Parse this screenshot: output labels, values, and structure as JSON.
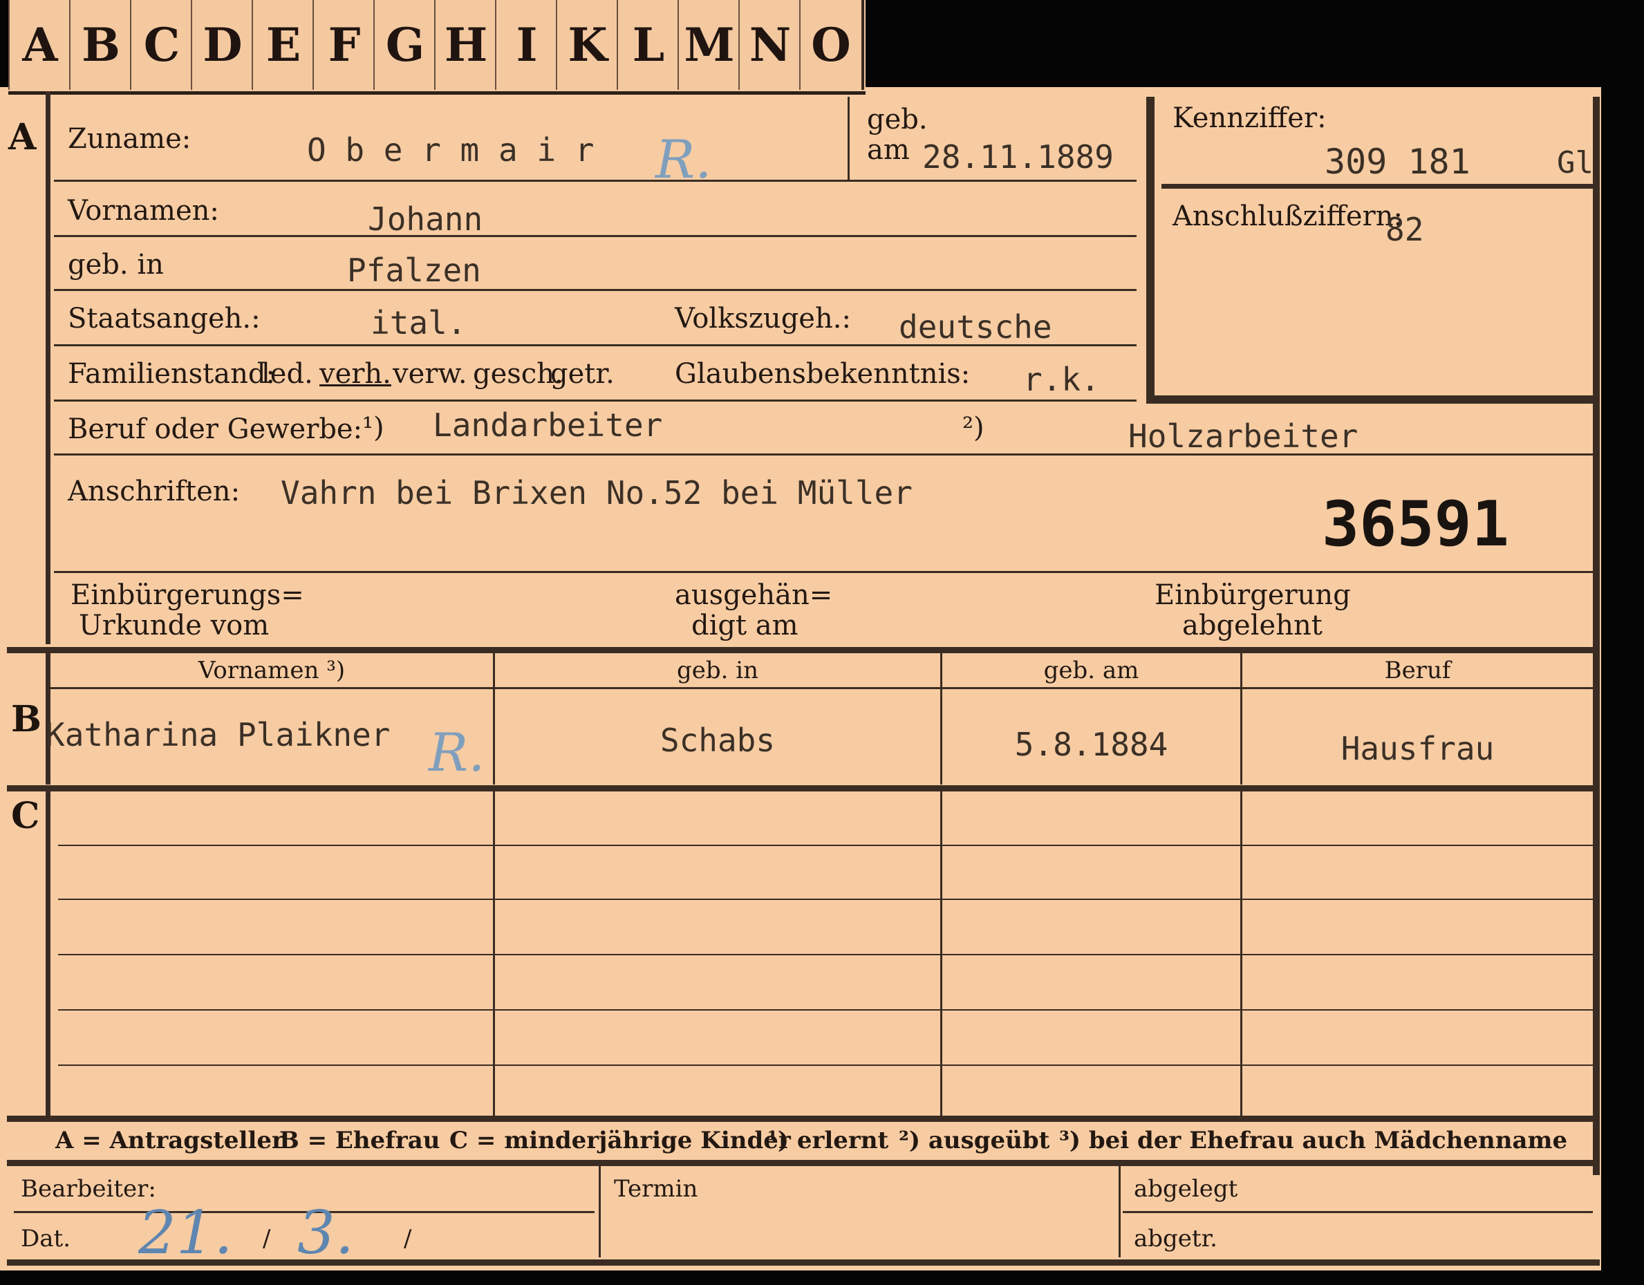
{
  "tabs": [
    "A",
    "B",
    "C",
    "D",
    "E",
    "F",
    "G",
    "H",
    "I",
    "K",
    "L",
    "M",
    "N",
    "O"
  ],
  "section_a": {
    "letter": "A",
    "zuname_label": "Zuname:",
    "zuname_value": "O b e r m a i r",
    "geb_label": "geb.",
    "am_label": "am",
    "birth_date": "28.11.1889",
    "vornamen_label": "Vornamen:",
    "vornamen_value": "Johann",
    "geb_in_label": "geb. in",
    "geb_in_value": "Pfalzen",
    "staatsangeh_label": "Staatsangeh.:",
    "staatsangeh_value": "ital.",
    "volkszugeh_label": "Volkszugeh.:",
    "volkszugeh_value": "deutsche",
    "familienstand_label": "Familienstand:",
    "familienstand_options": [
      "led.",
      "verh.",
      "verw.",
      "gesch.",
      "getr."
    ],
    "familienstand_selected": "verh.",
    "glauben_label": "Glaubensbekenntnis:",
    "glauben_value": "r.k.",
    "beruf_label": "Beruf oder Gewerbe:",
    "beruf_mark1": "¹)",
    "beruf_value1": "Landarbeiter",
    "beruf_mark2": "²)",
    "beruf_value2": "Holzarbeiter",
    "anschriften_label": "Anschriften:",
    "anschriften_value": "Vahrn bei Brixen No.52 bei Müller",
    "stamp_number": "36591",
    "einbuergerung_label_1": "Einbürgerungs=",
    "einbuergerung_label_2": "Urkunde vom",
    "ausgehaendigt_label_1": "ausgehän=",
    "ausgehaendigt_label_2": "digt am",
    "abgelehnt_label_1": "Einbürgerung",
    "abgelehnt_label_2": "abgelehnt",
    "handwritten_mark": "R."
  },
  "kennziffer": {
    "label": "Kennziffer:",
    "value": "309 181",
    "suffix": "Gl",
    "anschluss_label": "Anschlußziffern:",
    "anschluss_value": "82"
  },
  "section_b": {
    "letter": "B",
    "headers": [
      "Vornamen ³)",
      "geb. in",
      "geb. am",
      "Beruf"
    ],
    "row": [
      "Katharina Plaikner",
      "Schabs",
      "5.8.1884",
      "Hausfrau"
    ],
    "handwritten_mark": "R."
  },
  "section_c": {
    "letter": "C"
  },
  "legend": {
    "a": "A = Antragsteller",
    "b": "B = Ehefrau",
    "c": "C = minderjährige Kinder",
    "n1": "¹) erlernt",
    "n2": "²) ausgeübt",
    "n3": "³) bei der Ehefrau auch Mädchenname"
  },
  "footer": {
    "bearbeiter_label": "Bearbeiter:",
    "dat_label": "Dat.",
    "dat_day": "21.",
    "dat_sep1": "/",
    "dat_month": "3.",
    "dat_sep2": "/",
    "termin_label": "Termin",
    "abgelegt_label": "abgelegt",
    "abgetr_label": "abgetr."
  }
}
